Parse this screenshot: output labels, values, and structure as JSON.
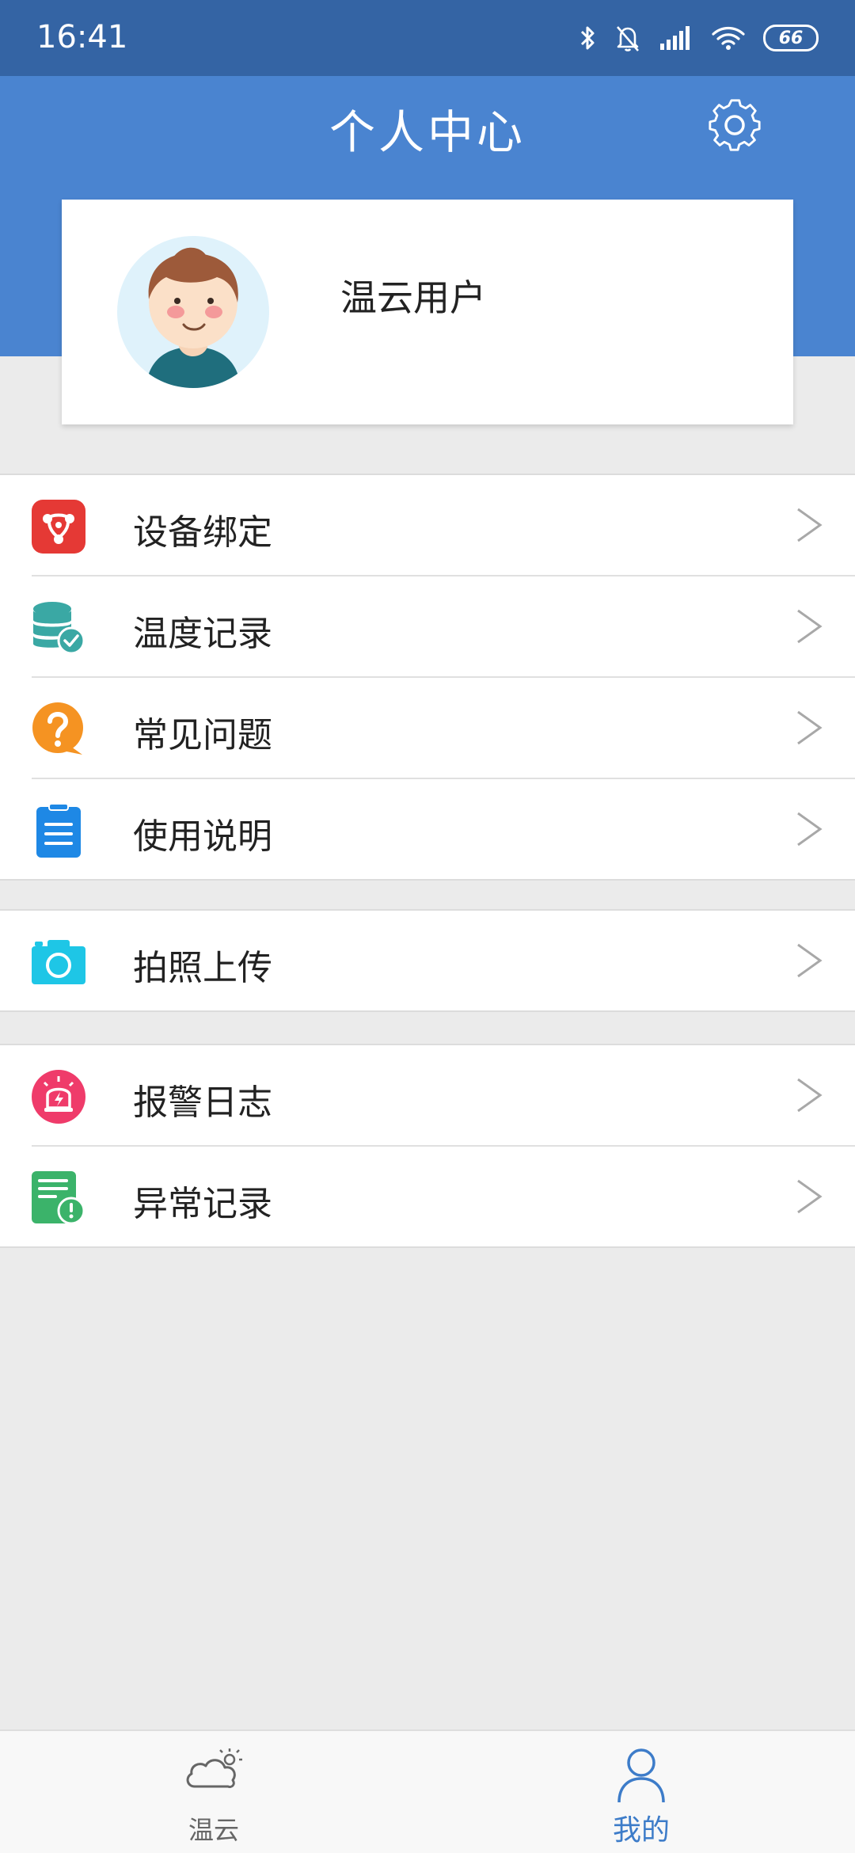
{
  "status_bar": {
    "time": "16:41",
    "battery": "66"
  },
  "header": {
    "title": "个人中心",
    "settings_icon": "gear-icon"
  },
  "profile": {
    "name": "温云用户",
    "avatar": "boy-avatar"
  },
  "menu_groups": [
    {
      "items": [
        {
          "label": "设备绑定",
          "icon": "device-binding-icon",
          "color": "#e53935"
        },
        {
          "label": "温度记录",
          "icon": "database-check-icon",
          "color": "#3aa8a4"
        },
        {
          "label": "常见问题",
          "icon": "question-bubble-icon",
          "color": "#f59322"
        },
        {
          "label": "使用说明",
          "icon": "clipboard-list-icon",
          "color": "#1e88e5"
        }
      ]
    },
    {
      "items": [
        {
          "label": "拍照上传",
          "icon": "camera-icon",
          "color": "#1ec6e6"
        }
      ]
    },
    {
      "items": [
        {
          "label": "报警日志",
          "icon": "alarm-light-icon",
          "color": "#ef3b6a"
        },
        {
          "label": "异常记录",
          "icon": "abnormal-record-icon",
          "color": "#3bb36a"
        }
      ]
    }
  ],
  "bottom_nav": [
    {
      "label": "温云",
      "icon": "cloud-weather-icon",
      "active": false
    },
    {
      "label": "我的",
      "icon": "person-icon",
      "active": true
    }
  ],
  "colors": {
    "header": "#4a84d0",
    "status_bar": "#3464a4",
    "active_tab": "#3d7cc9",
    "inactive_tab": "#666666"
  }
}
